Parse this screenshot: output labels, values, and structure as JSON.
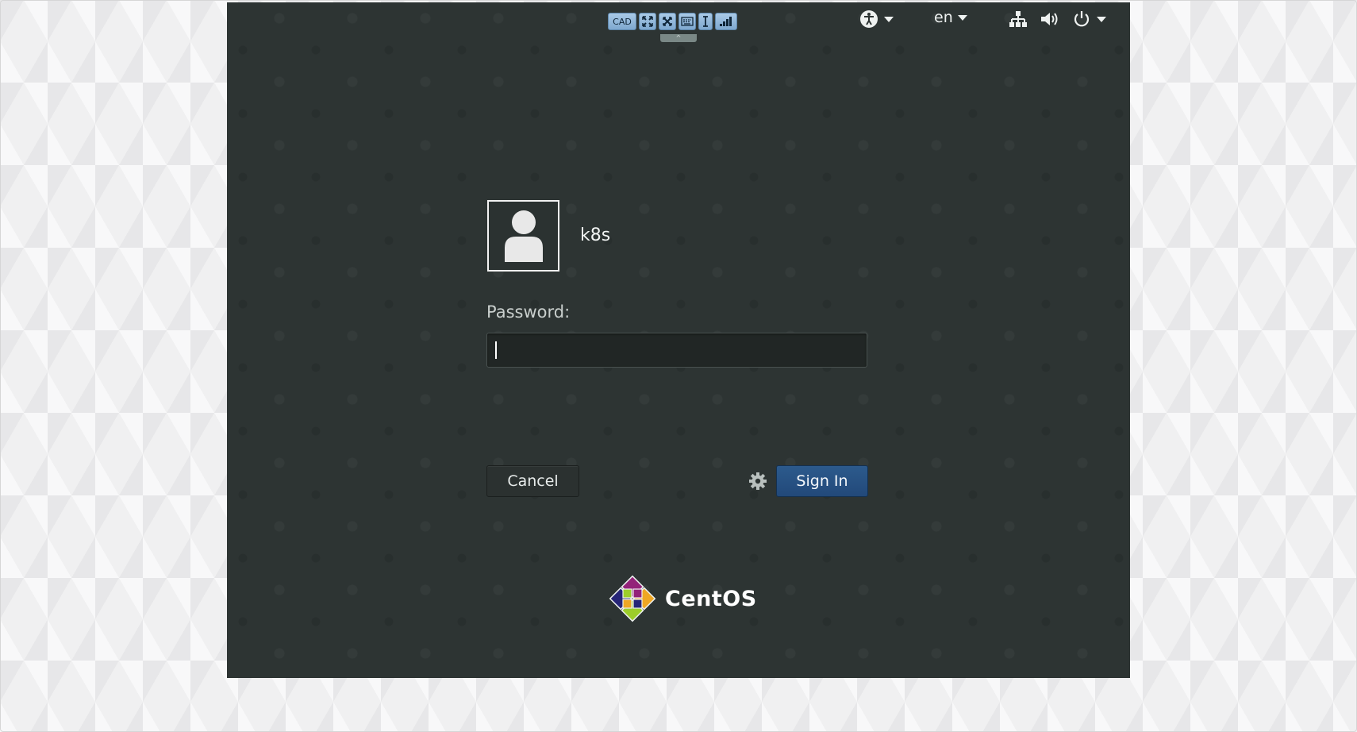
{
  "vm_toolbar": {
    "cad_label": "CAD",
    "buttons": [
      "fullscreen-icon",
      "scale-icon",
      "keyboard-icon",
      "text-cursor-icon",
      "signal-icon"
    ],
    "handle_label": "^"
  },
  "top_panel": {
    "accessibility_icon": "accessibility-icon",
    "language": "en",
    "network_icon": "network-icon",
    "volume_icon": "volume-icon",
    "power_icon": "power-icon"
  },
  "login": {
    "username": "k8s",
    "password_label": "Password:",
    "password_value": "",
    "cancel_label": "Cancel",
    "signin_label": "Sign In",
    "settings_icon": "gear-icon"
  },
  "branding": {
    "logo_text": "CentOS"
  },
  "colors": {
    "screen_bg": "#2d3433",
    "signin_bg": "#2c5a8c",
    "toolbar_btn": "#7ea8cf"
  }
}
